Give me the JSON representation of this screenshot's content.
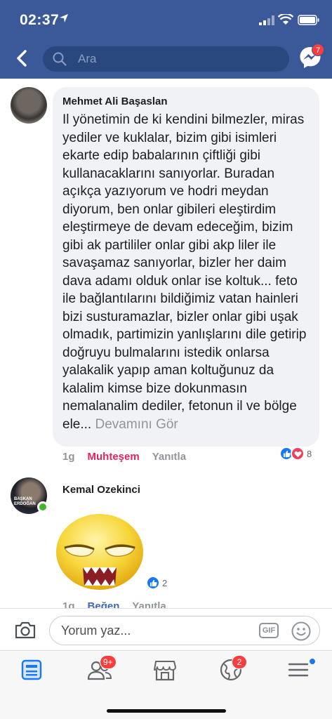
{
  "status_bar": {
    "time": "02:37"
  },
  "header": {
    "search_placeholder": "Ara",
    "messenger_badge": "7",
    "brand_color": "#3b5998"
  },
  "comments": [
    {
      "author": "Mehmet Ali Başaslan",
      "text": "Il yönetimin de ki kendini bilmezler, miras yediler ve kuklalar, bizim gibi isimleri ekarte edip babalarının çiftliği gibi kullanacaklarını sanıyorlar. Buradan açıkça yazıyorum ve hodri meydan diyorum, ben onlar gibileri eleştirdim eleştirmeye de devam edeceğim, bizim gibi ak partililer onlar gibi akp liler ile savaşamaz sanıyorlar, bizler her daim dava adamı olduk onlar ise koltuk... feto ile bağlantılarını bildiğimiz vatan hainleri bizi susturamazlar, bizler onlar gibi uşak olmadık, partimizin yanlışlarını dile getirip doğruyu bulmalarını istedik onlarsa yalakalik yapıp aman koltuğunuz da kalalim kimse bize dokunmasın nemalanalim dediler, fetonun il ve bölge ele...",
      "see_more": "Devamını Gör",
      "time": "1g",
      "reaction_label": "Muhteşem",
      "reply_label": "Yanıtla",
      "reaction_count": "8",
      "reactions": [
        "like-icon",
        "love-icon"
      ]
    },
    {
      "author": "Kemal Ozekinci",
      "avatar_text": "BAŞKAN ERDOĞAN",
      "sticker": "grumpy-emoji-sticker",
      "time": "1g",
      "like_label": "Beğen",
      "reply_label": "Yanıtla",
      "reaction_count": "2",
      "reactions": [
        "like-icon"
      ],
      "online": true
    }
  ],
  "composer": {
    "placeholder": "Yorum yaz...",
    "gif_label": "GIF"
  },
  "tabbar": {
    "friends_badge": "9+",
    "notifications_badge": "2"
  }
}
